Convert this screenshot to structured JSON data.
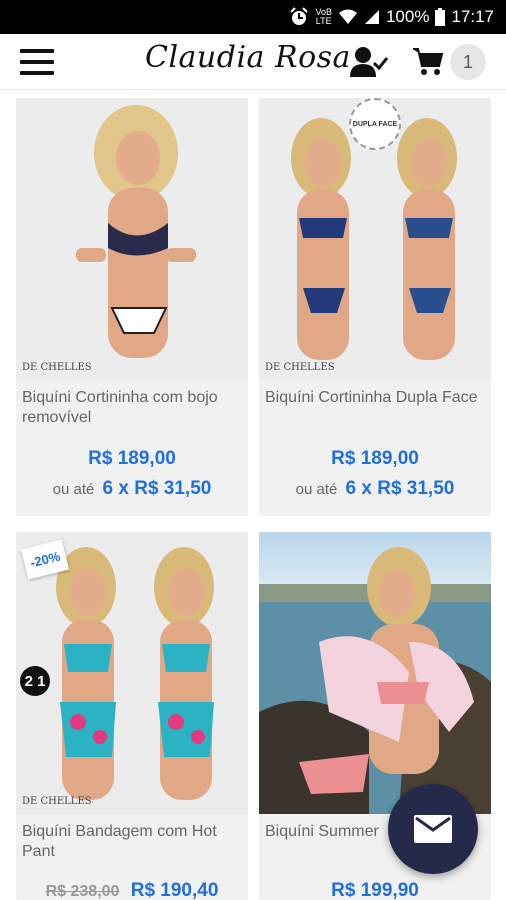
{
  "status_bar": {
    "network_top": "VoB",
    "network_bottom": "LTE",
    "battery": "100%",
    "time": "17:17"
  },
  "header": {
    "logo_text": "Claudia Rosa",
    "cart_count": "1"
  },
  "products": [
    {
      "name": "Biquíni Cortininha com bojo removível",
      "price": "R$ 189,00",
      "installment_prefix": "ou até",
      "installment_value": "6 x R$ 31,50",
      "brand_mark": "DE CHELLES"
    },
    {
      "name": "Biquíni Cortininha Dupla Face",
      "price": "R$ 189,00",
      "installment_prefix": "ou até",
      "installment_value": "6 x R$ 31,50",
      "badge": "DUPLA FACE",
      "brand_mark": "DE CHELLES"
    },
    {
      "name": "Biquíni Bandagem com Hot Pant",
      "old_price": "R$ 238,00",
      "price": "R$ 190,40",
      "discount": "-20%",
      "badge": "2 1",
      "brand_mark": "DE CHELLES"
    },
    {
      "name": "Biquíni Summer",
      "price": "R$ 199,90"
    }
  ],
  "colors": {
    "price": "#1f6fe0",
    "fab": "#252a4a",
    "card_bg": "#f1f1f1"
  }
}
